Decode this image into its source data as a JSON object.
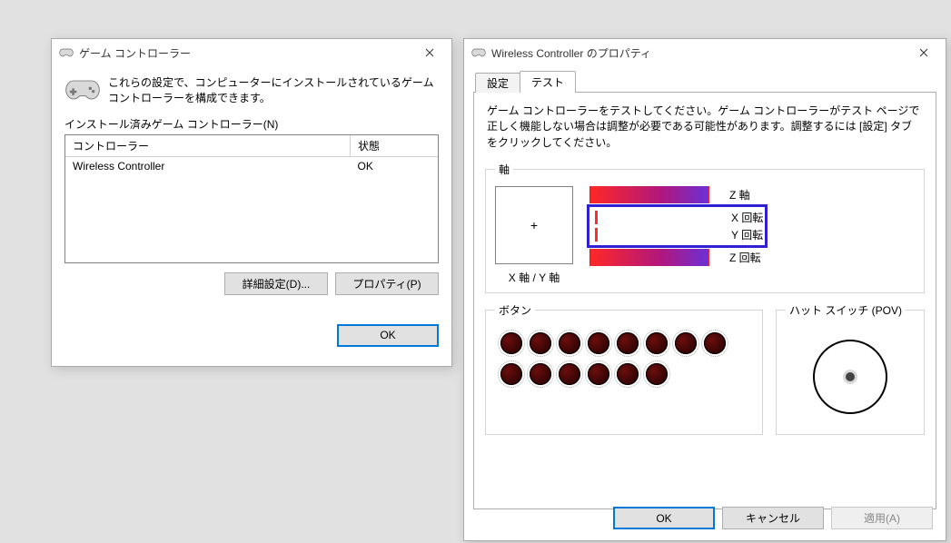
{
  "win1": {
    "title": "ゲーム コントローラー",
    "intro": "これらの設定で、コンピューターにインストールされているゲーム コントローラーを構成できます。",
    "list_label": "インストール済みゲーム コントローラー(N)",
    "columns": {
      "controller": "コントローラー",
      "status": "状態"
    },
    "rows": [
      {
        "name": "Wireless Controller",
        "status": "OK"
      }
    ],
    "buttons": {
      "advanced": "詳細設定(D)...",
      "properties": "プロパティ(P)",
      "ok": "OK"
    }
  },
  "win2": {
    "title": "Wireless Controller のプロパティ",
    "tabs": {
      "settings": "設定",
      "test": "テスト"
    },
    "active_tab": "test",
    "instruction": "ゲーム コントローラーをテストしてください。ゲーム コントローラーがテスト ページで正しく機能しない場合は調整が必要である可能性があります。調整するには [設定] タブをクリックしてください。",
    "axis": {
      "group_label": "軸",
      "xy_label": "X 軸 / Y 軸",
      "bars": [
        {
          "label": "Z 軸",
          "style": "gradient"
        },
        {
          "label": "X 回転",
          "style": "tick",
          "highlighted": true
        },
        {
          "label": "Y 回転",
          "style": "tick",
          "highlighted": true
        },
        {
          "label": "Z 回転",
          "style": "gradient"
        }
      ]
    },
    "buttons_group": {
      "label": "ボタン",
      "rows": [
        8,
        6
      ]
    },
    "pov_group": {
      "label": "ハット スイッチ (POV)"
    },
    "footer": {
      "ok": "OK",
      "cancel": "キャンセル",
      "apply": "適用(A)"
    }
  }
}
